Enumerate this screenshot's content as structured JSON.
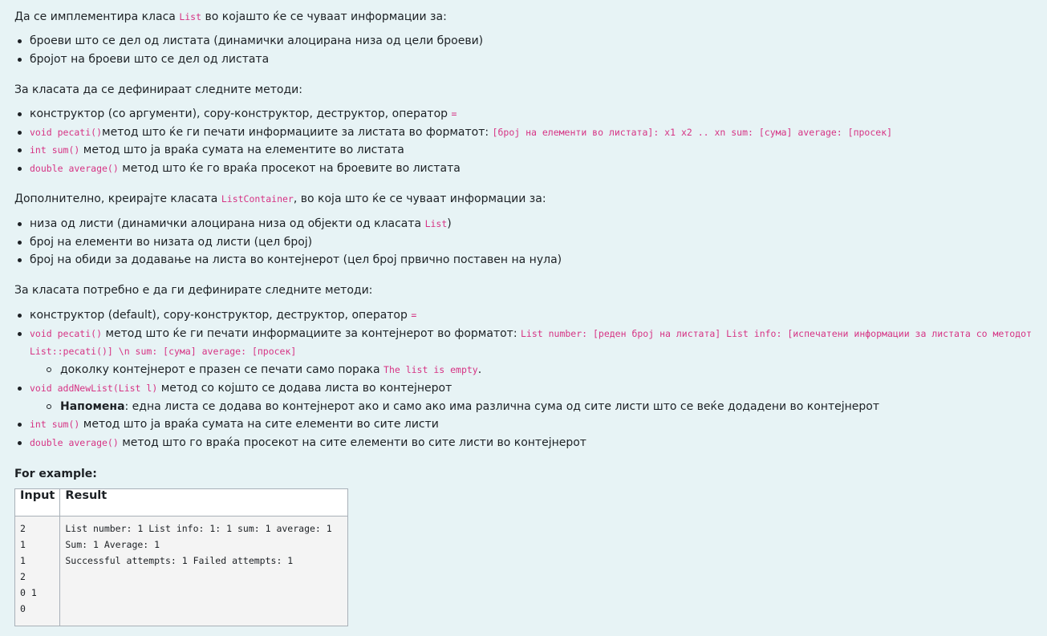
{
  "intro": {
    "before": "Да се имплементира класа ",
    "class_code": "List",
    "after": " во којашто ќе се чуваат информации за:"
  },
  "list_fields": [
    "броеви што се дел од листата (динамички алоцирана низа од цели броеви)",
    "бројот на броеви што се дел од листата"
  ],
  "list_methods_intro": "За класата да се дефинираат следните методи:",
  "list_methods": {
    "m1_text": "конструктор (со аргументи), copy-конструктор, деструктор, оператор ",
    "m1_code": "=",
    "m2_code": "void pecati()",
    "m2_text": "метод што ќе ги печати информациите за листата во форматот: ",
    "m2_format": "[број на елементи во листата]: x1 x2 .. xn sum: [сума] average: [просек]",
    "m3_code": "int sum()",
    "m3_text": " метод што ја враќа сумата на елементите во листата",
    "m4_code": "double average()",
    "m4_text": " метод што ќе го враќа просекот на броевите во листата"
  },
  "container_intro": {
    "before": "Дополнително, креирајте класата ",
    "class_code": "ListContainer",
    "after": ", во која што ќе се чуваат информации за:"
  },
  "container_fields": {
    "f1_text": "низа од листи (динамички алоцирана низа од објекти од класата ",
    "f1_code": "List",
    "f1_end": ")",
    "f2_text": "број на елементи во низата од листи (цел број)",
    "f3_text": "број на обиди за додавање на листа во контејнерот (цел број првично поставен на нула)"
  },
  "container_methods_intro": "За класата потребно е да ги дефинирате следните методи:",
  "container_methods": {
    "m1_text": "конструктор (default), copy-конструктор, деструктор, оператор ",
    "m1_code": "=",
    "m2_code": "void pecati()",
    "m2_text": " метод што ќе ги печати информациите за контејнерот во форматот: ",
    "m2_format_line1": "List number: [реден број на листата] List info: [испечатени информации за листата со методот",
    "m2_format_line2": "List::pecati()] \\n sum: [сума] average: [просек]",
    "m2_sub_text": "доколку контејнерот е празен се печати само порака ",
    "m2_sub_code": "The list is empty",
    "m2_sub_end": ".",
    "m3_code": "void addNewList(List l)",
    "m3_text": " метод со којшто се додава листа во контејнерот",
    "m3_note_bold": "Напомена",
    "m3_note_text": ": една листа се додава во контејнерот ако и само ако има различна сума од сите листи што се веќе додадени во контејнерот",
    "m4_code": "int sum()",
    "m4_text": " метод што ја враќа сумата на сите елементи во сите листи",
    "m5_code": "double average()",
    "m5_text": " метод што го враќа просекот на сите елементи во сите листи во контејнерот"
  },
  "example": {
    "heading": "For example:",
    "col_input": "Input",
    "col_result": "Result",
    "input_text": "2\n1\n1\n2\n0 1\n0",
    "result_text": "List number: 1 List info: 1: 1 sum: 1 average: 1\nSum: 1 Average: 1\nSuccessful attempts: 1 Failed attempts: 1"
  }
}
